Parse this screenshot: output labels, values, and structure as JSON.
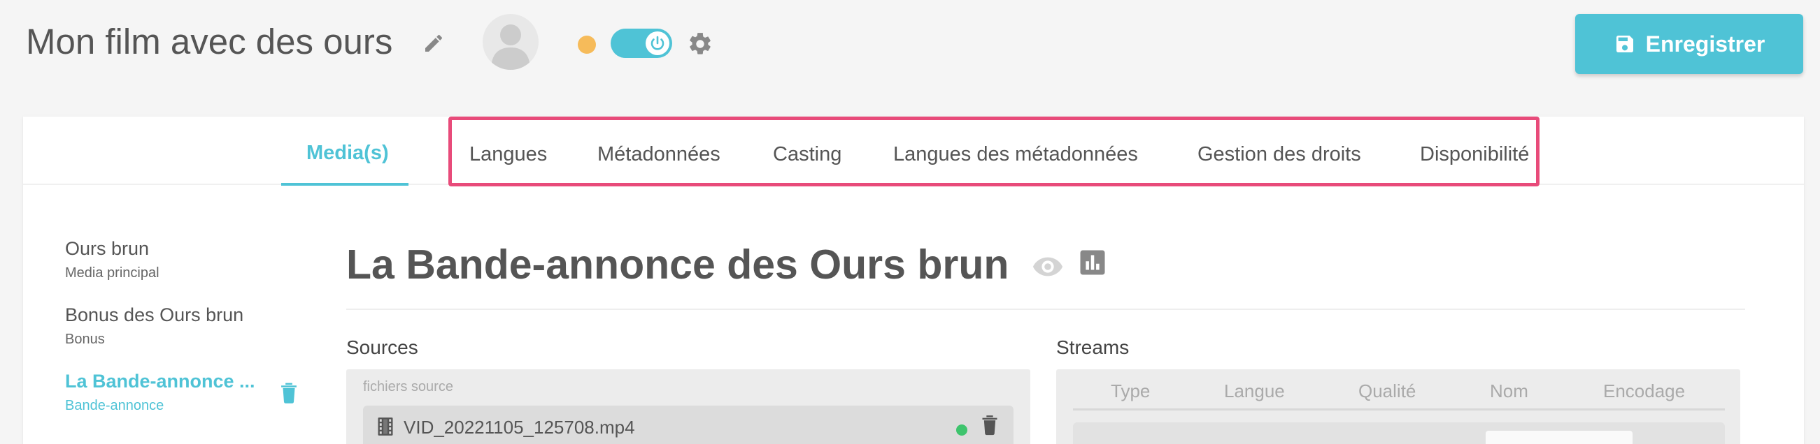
{
  "header": {
    "title": "Mon film avec des ours",
    "save_label": "Enregistrer"
  },
  "colors": {
    "accent": "#4fc3d6",
    "status_pending": "#f6bb5a",
    "highlight": "#e84b7a",
    "ready": "#3ec46d"
  },
  "icons": {
    "edit": "pencil-icon",
    "avatar": "user-silhouette",
    "toggle": "power-icon",
    "settings": "gear-icon",
    "save": "floppy-disk-icon",
    "view": "eye-icon",
    "stats": "bar-chart-icon",
    "delete": "trash-icon",
    "file": "film-icon"
  },
  "tabs": {
    "active": "Media(s)",
    "items": [
      "Langues",
      "Métadonnées",
      "Casting",
      "Langues des métadonnées",
      "Gestion des droits",
      "Disponibilité"
    ]
  },
  "sidebar": {
    "items": [
      {
        "title": "Ours brun",
        "subtitle": "Media principal",
        "active": false
      },
      {
        "title": "Bonus des Ours brun",
        "subtitle": "Bonus",
        "active": false
      },
      {
        "title": "La Bande-annonce ...",
        "subtitle": "Bande-annonce",
        "active": true
      }
    ]
  },
  "media": {
    "title": "La Bande-annonce des Ours brun"
  },
  "sources": {
    "label": "Sources",
    "caption": "fichiers source",
    "files": [
      {
        "name": "VID_20221105_125708.mp4",
        "status": "ready"
      }
    ]
  },
  "streams": {
    "label": "Streams",
    "columns": [
      "Type",
      "Langue",
      "Qualité",
      "Nom",
      "Encodage"
    ]
  }
}
